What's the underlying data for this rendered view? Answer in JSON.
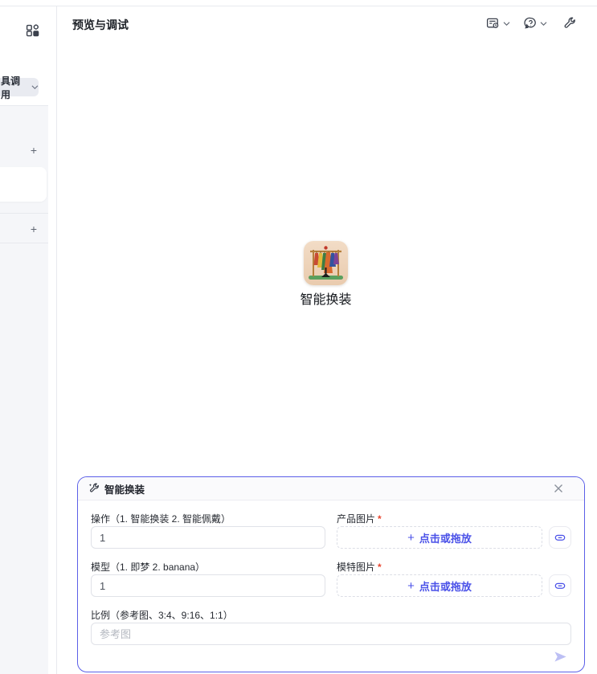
{
  "header": {
    "title": "预览与调试",
    "toolbar": [
      {
        "name": "preview-record-icon",
        "dropdown": true
      },
      {
        "name": "debug-think-icon",
        "dropdown": true
      },
      {
        "name": "tools-wrench-icon",
        "dropdown": false
      }
    ]
  },
  "sidebar": {
    "apps_icon": "apps-grid-icon",
    "section_label": "具调用",
    "add_label": "+"
  },
  "canvas": {
    "app_name": "智能换装",
    "app_icon": "clothes-rack-illustration"
  },
  "form": {
    "title": "智能换装",
    "title_icon": "magic-wrench-icon",
    "close_icon": "close-icon",
    "required_mark": "*",
    "rows": {
      "action": {
        "label": "操作（1. 智能换装 2. 智能佩戴）",
        "value": "1"
      },
      "product_img": {
        "label": "产品图片",
        "upload_plus": "+",
        "upload_label": "点击或拖放",
        "link_icon": "link-icon"
      },
      "model": {
        "label": "模型（1. 即梦 2. banana）",
        "value": "1"
      },
      "model_img": {
        "label": "模特图片",
        "upload_plus": "+",
        "upload_label": "点击或拖放",
        "link_icon": "link-icon"
      },
      "ratio": {
        "label": "比例（参考图、3:4、9:16、1:1）",
        "placeholder": "参考图"
      }
    },
    "send_icon": "send-icon"
  },
  "colors": {
    "accent_border": "#5b5fe8",
    "upload_link": "#4a51e8",
    "required": "#e8462f",
    "send_disabled": "#bcbff4",
    "sidebar_bg": "#f5f6f9",
    "divider": "#e7e9ee"
  }
}
